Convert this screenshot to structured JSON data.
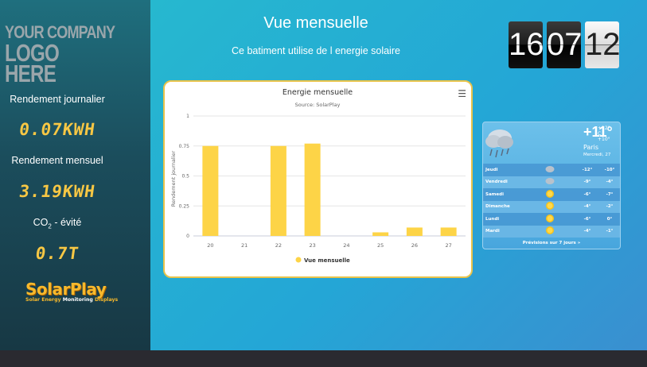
{
  "sidebar": {
    "logo_line1": "YOUR COMPANY",
    "logo_line2": "LOGO HERE",
    "daily_label": "Rendement journalier",
    "daily_value": "0.07KWH",
    "monthly_label": "Rendement mensuel",
    "monthly_value": "3.19KWH",
    "co2_label_prefix": "CO",
    "co2_label_sub": "2",
    "co2_label_suffix": " - évité",
    "co2_value": "0.7T",
    "brand_name": "SolarPlay",
    "brand_tag_1": "Solar ",
    "brand_tag_2": "Energy",
    "brand_tag_3": " Monitoring ",
    "brand_tag_4": "Displays"
  },
  "header": {
    "title": "Vue mensuelle",
    "subtitle": "Ce batiment utilise de l energie solaire"
  },
  "clock": {
    "hours": "16",
    "minutes": "07",
    "seconds": "12"
  },
  "chart_data": {
    "type": "bar",
    "title": "Energie mensuelle",
    "subtitle": "Source: SolarPlay",
    "xlabel": "",
    "ylabel": "Rendement journalier",
    "categories": [
      "20",
      "21",
      "22",
      "23",
      "24",
      "25",
      "26",
      "27"
    ],
    "series": [
      {
        "name": "Vue mensuelle",
        "values": [
          0.75,
          0,
          0.75,
          0.77,
          0,
          0.03,
          0.07,
          0.07
        ]
      }
    ],
    "ylim": [
      0,
      1
    ],
    "yticks": [
      "0",
      "0.25",
      "0.5",
      "0.75",
      "1"
    ],
    "grid": true,
    "legend": "bottom-center",
    "color": "#fdd447"
  },
  "weather": {
    "temp": "+11°",
    "unit": "C",
    "hi": "+12°",
    "lo": "+10°",
    "city": "Paris",
    "date": "Mercredi, 27",
    "icon": "cloud-rain-icon",
    "days": [
      {
        "day": "Jeudi",
        "icon": "cloud-icon",
        "hi": "-12°",
        "lo": "-10°"
      },
      {
        "day": "Vendredi",
        "icon": "cloud-icon",
        "hi": "-9°",
        "lo": "-4°"
      },
      {
        "day": "Samedi",
        "icon": "sun-icon",
        "hi": "-6°",
        "lo": "-7°"
      },
      {
        "day": "Dimanche",
        "icon": "sun-cloud-icon",
        "hi": "-4°",
        "lo": "-2°"
      },
      {
        "day": "Lundi",
        "icon": "sun-icon",
        "hi": "-6°",
        "lo": "0°"
      },
      {
        "day": "Mardi",
        "icon": "sun-icon",
        "hi": "-4°",
        "lo": "-1°"
      }
    ],
    "footer": "Prévisions sur 7 jours »"
  }
}
